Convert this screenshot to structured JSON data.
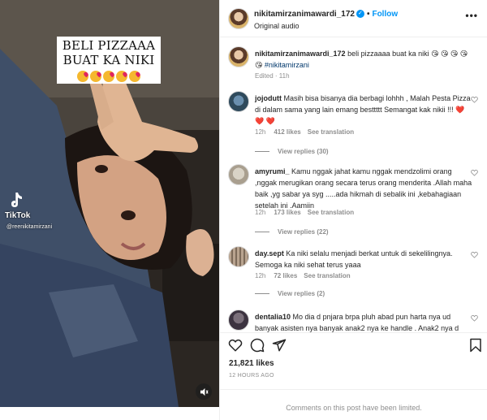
{
  "video": {
    "caption_line1": "BELI PIZZAAA",
    "caption_line2": "BUAT KA NIKI",
    "emoji_count": 5,
    "watermark_brand": "TikTok",
    "watermark_handle": "@reenikitamirzani"
  },
  "header": {
    "username": "nikitamirzanimawardi_172",
    "separator": "•",
    "follow_label": "Follow",
    "audio_label": "Original audio",
    "more_label": "•••"
  },
  "post": {
    "username": "nikitamirzanimawardi_172",
    "caption": "beli pizzaaaa buat ka niki 😘 😘 😘 😘 😘",
    "hashtag": "#nikitamirzani",
    "meta": "Edited · 11h"
  },
  "comments": [
    {
      "username": "jojodutt",
      "text": "Masih bisa bisanya dia berbagi lohhh , Malah Pesta Pizza di dalam sama yang lain emang besttttt Semangat kak nikii !!!",
      "hearts": "❤️ ❤️ ❤️",
      "time": "12h",
      "likes": "412 likes",
      "translate": "See translation",
      "replies": "View replies (30)"
    },
    {
      "username": "amyrumi_",
      "text": "Kamu nggak jahat kamu nggak mendzolimi orang ,nggak merugikan orang secara terus orang menderita .Allah maha baik ,yg sabar ya syg .....ada hikmah di sebalik ini ,kebahagiaan setelah ini .Aamiin",
      "time": "12h",
      "likes": "173 likes",
      "translate": "See translation",
      "replies": "View replies (22)"
    },
    {
      "username": "day.sept",
      "text": "Ka niki selalu menjadi berkat untuk di sekelilingnya. Semoga ka niki sehat terus yaaa",
      "time": "12h",
      "likes": "72 likes",
      "translate": "See translation",
      "replies": "View replies (2)"
    },
    {
      "username": "dentalia10",
      "text": "Mo dia d pnjara brpa pluh abad pun harta nya ud banyak asisten nya banyak anak2 nya ke handle . Anak2 nya d"
    }
  ],
  "actions": {
    "likes": "21,821 likes",
    "time_ago": "12 HOURS AGO"
  },
  "footer": {
    "limited_text": "Comments on this post have been limited."
  },
  "colors": {
    "accent": "#0095f6",
    "hashtag": "#00376b",
    "secondary_text": "#8e8e8e",
    "heart": "#ed4956"
  }
}
